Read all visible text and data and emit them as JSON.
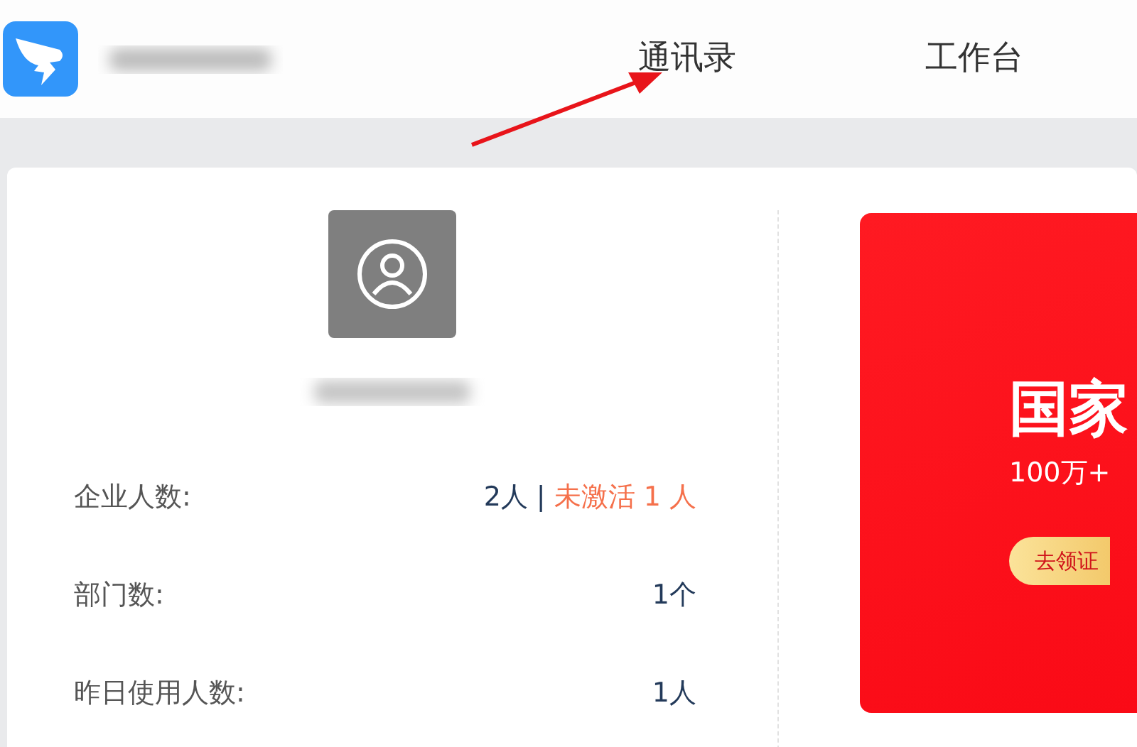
{
  "header": {
    "nav": [
      {
        "label": "通讯录"
      },
      {
        "label": "工作台"
      }
    ]
  },
  "stats": [
    {
      "label": "企业人数:",
      "values": [
        {
          "text": "2人",
          "kind": "count"
        },
        {
          "text": "|",
          "kind": "divider"
        },
        {
          "text": "未激活 1 人",
          "kind": "inactive"
        }
      ]
    },
    {
      "label": "部门数:",
      "values": [
        {
          "text": "1个",
          "kind": "count"
        }
      ]
    },
    {
      "label": "昨日使用人数:",
      "values": [
        {
          "text": "1人",
          "kind": "count"
        }
      ]
    }
  ],
  "banner": {
    "headline": "国家",
    "subline": "100万+",
    "button": "去领证"
  }
}
